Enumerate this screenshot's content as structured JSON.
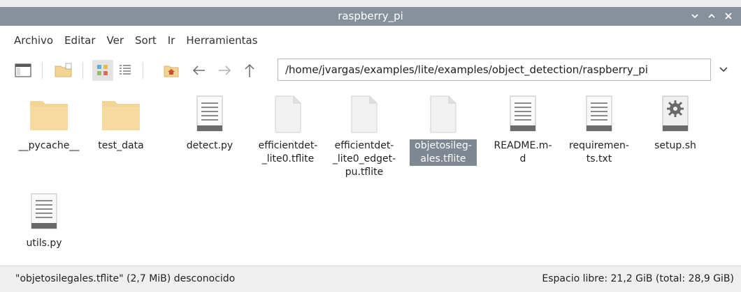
{
  "window": {
    "title": "raspberry_pi",
    "controls": {
      "minimize": "⌄",
      "maximize": "⌃",
      "close": "✕"
    }
  },
  "menu": {
    "items": [
      "Archivo",
      "Editar",
      "Ver",
      "Sort",
      "Ir",
      "Herramientas"
    ]
  },
  "toolbar": {
    "path": "/home/jvargas/examples/lite/examples/object_detection/raspberry_pi"
  },
  "files": [
    {
      "name": "__pycache__",
      "type": "folder"
    },
    {
      "name": "test_data",
      "type": "folder"
    },
    {
      "name": "detect.py",
      "type": "text"
    },
    {
      "name": "efficientdet-\n_lite0.tflite",
      "type": "blank"
    },
    {
      "name": "efficientdet-\n_lite0_edget-\npu.tflite",
      "type": "blank"
    },
    {
      "name": "objetosileg-\nales.tflite",
      "type": "blank",
      "selected": true
    },
    {
      "name": "README.m-\nd",
      "type": "text"
    },
    {
      "name": "requiremen-\nts.txt",
      "type": "text"
    },
    {
      "name": "setup.sh",
      "type": "script"
    },
    {
      "name": "utils.py",
      "type": "text"
    }
  ],
  "status": {
    "left": "\"objetosilegales.tflite\" (2,7 MiB) desconocido",
    "right": "Espacio libre: 21,2 GiB (total: 28,9 GiB)"
  },
  "colors": {
    "titlebar": "#87919b",
    "folder": "#f4d492",
    "selection": "#7d8893"
  }
}
